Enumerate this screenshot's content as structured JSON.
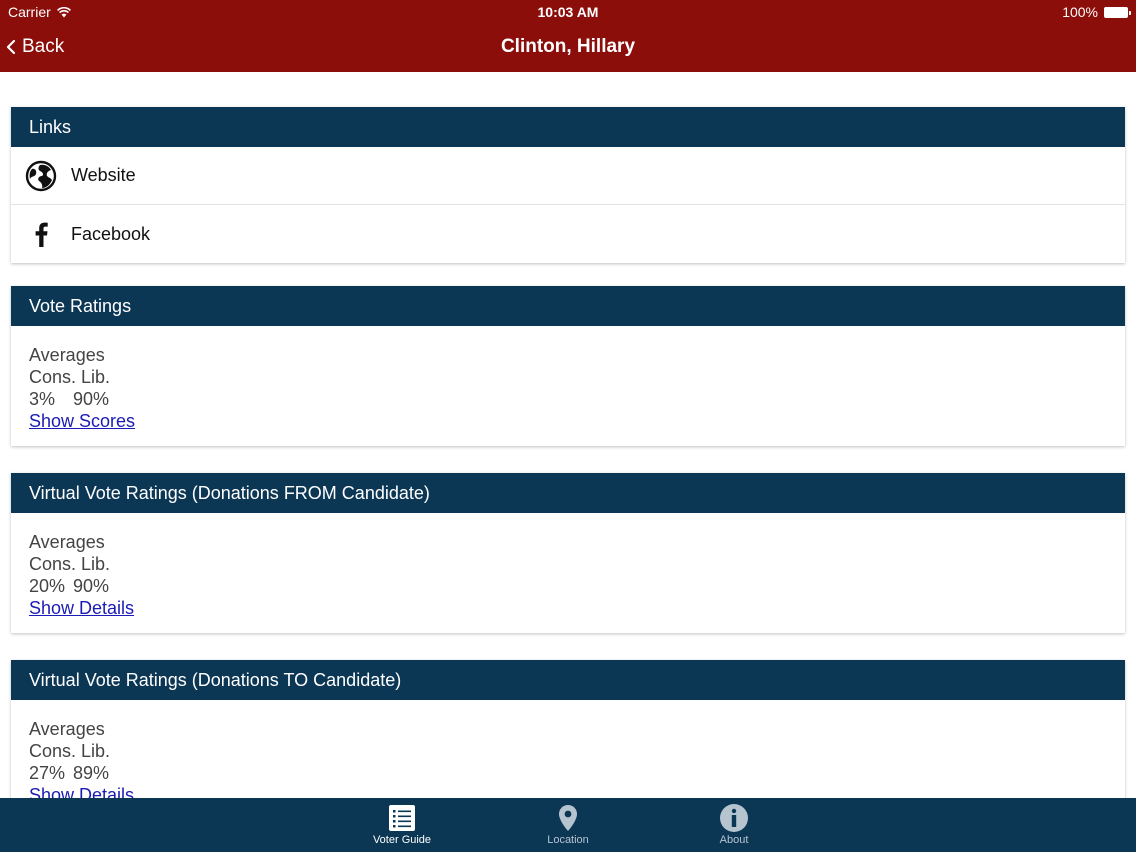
{
  "status": {
    "carrier": "Carrier",
    "time": "10:03 AM",
    "battery": "100%"
  },
  "nav": {
    "back_label": "Back",
    "title": "Clinton, Hillary"
  },
  "links": {
    "header": "Links",
    "items": [
      {
        "label": "Website",
        "icon": "globe-icon"
      },
      {
        "label": "Facebook",
        "icon": "facebook-icon"
      }
    ]
  },
  "vote_ratings": {
    "header": "Vote Ratings",
    "averages_label": "Averages",
    "cons_lib_label": "Cons. Lib.",
    "cons": "3%",
    "lib": "90%",
    "link": "Show Scores"
  },
  "virtual_from": {
    "header": "Virtual Vote Ratings (Donations FROM Candidate)",
    "averages_label": "Averages",
    "cons_lib_label": "Cons. Lib.",
    "cons": "20%",
    "lib": "90%",
    "link": "Show Details"
  },
  "virtual_to": {
    "header": "Virtual Vote Ratings (Donations TO Candidate)",
    "averages_label": "Averages",
    "cons_lib_label": "Cons. Lib.",
    "cons": "27%",
    "lib": "89%",
    "link": "Show Details"
  },
  "tabs": [
    {
      "label": "Voter Guide",
      "icon": "list-icon",
      "active": true
    },
    {
      "label": "Location",
      "icon": "location-pin-icon",
      "active": false
    },
    {
      "label": "About",
      "icon": "info-icon",
      "active": false
    }
  ]
}
